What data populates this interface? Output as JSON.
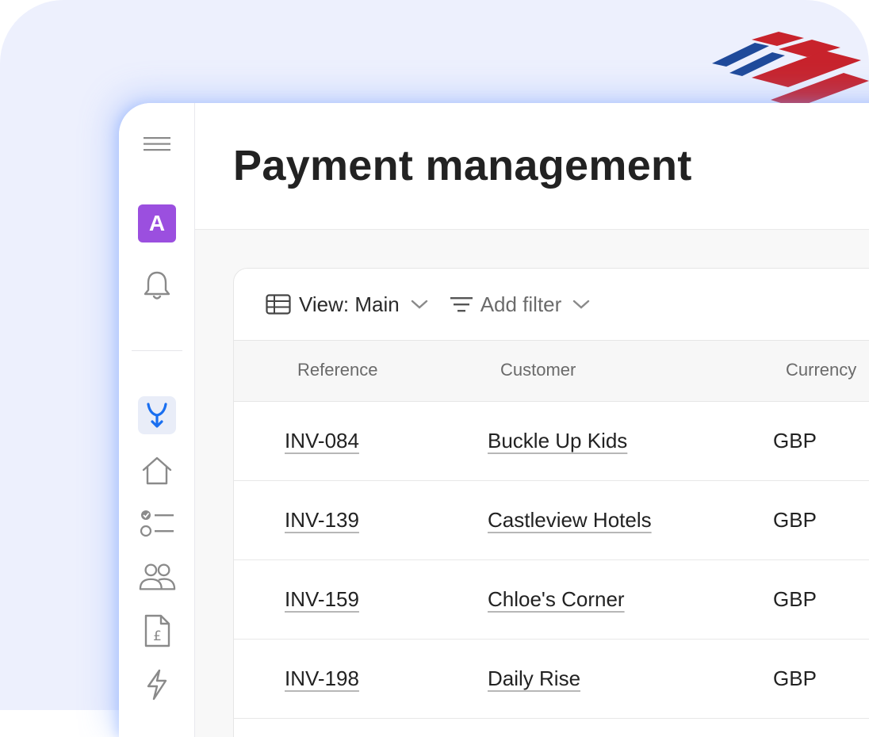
{
  "brand": {
    "red": "#c8232c",
    "blue": "#1f4a9a",
    "avatar_color": "#9b4fdf",
    "active_icon_color": "#1a6ff0"
  },
  "sidebar": {
    "avatar_letter": "A",
    "icons": [
      "menu-icon",
      "bell-icon",
      "merge-arrow-icon",
      "home-icon",
      "checklist-icon",
      "users-icon",
      "pound-document-icon",
      "lightning-icon"
    ]
  },
  "page": {
    "title": "Payment management"
  },
  "toolbar": {
    "view_label": "View: Main",
    "filter_label": "Add filter"
  },
  "table": {
    "columns": [
      "Reference",
      "Customer",
      "Currency"
    ],
    "rows": [
      {
        "reference": "INV-084",
        "customer": "Buckle Up Kids",
        "currency": "GBP"
      },
      {
        "reference": "INV-139",
        "customer": "Castleview Hotels",
        "currency": "GBP"
      },
      {
        "reference": "INV-159",
        "customer": "Chloe's Corner",
        "currency": "GBP"
      },
      {
        "reference": "INV-198",
        "customer": "Daily Rise",
        "currency": "GBP"
      }
    ]
  }
}
